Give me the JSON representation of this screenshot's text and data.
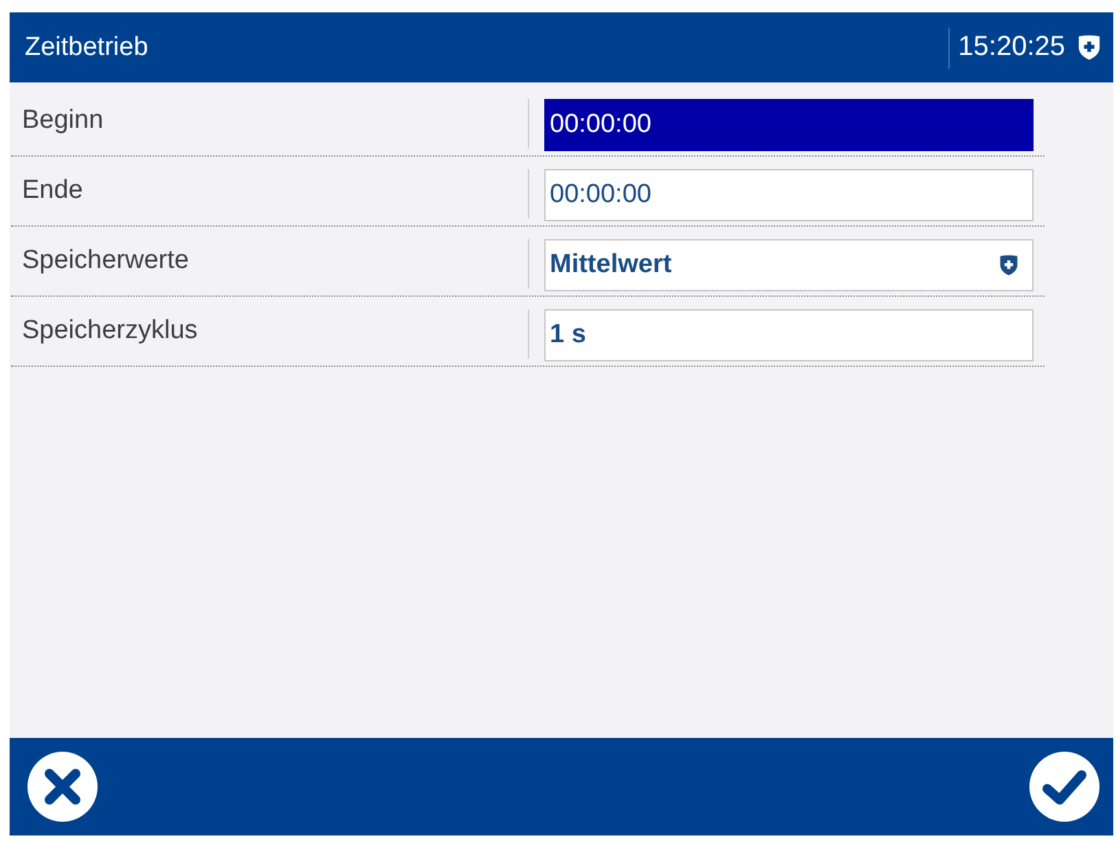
{
  "window": {
    "title": "Zeitbetrieb",
    "time": "15:20:25"
  },
  "settings": [
    {
      "label": "Beginn",
      "kind": "time",
      "value": "00:00:00",
      "selected": true
    },
    {
      "label": "Ende",
      "kind": "time",
      "value": "00:00:00",
      "selected": false
    },
    {
      "label": "Speicherwerte",
      "kind": "choice",
      "value": "Mittelwert",
      "selected": false
    },
    {
      "label": "Speicherzyklus",
      "kind": "number",
      "value": "1 s",
      "selected": false
    }
  ]
}
